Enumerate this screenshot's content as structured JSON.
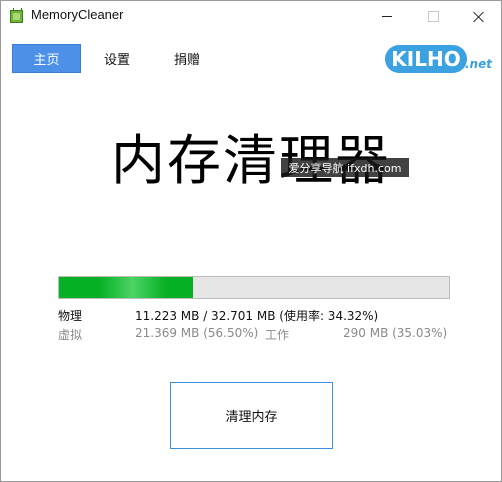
{
  "window": {
    "title": "MemoryCleaner"
  },
  "nav": {
    "home": "主页",
    "settings": "设置",
    "donate": "捐赠"
  },
  "logo": {
    "main": "KILHO",
    "suffix": ".net"
  },
  "main": {
    "heading": "内存清理器",
    "watermark": "爱分享导航 ifxdh.com"
  },
  "memory": {
    "usage_fraction": 0.3432,
    "physical_label": "物理",
    "physical_value": "11.223 MB / 32.701 MB (使用率: 34.32%)",
    "virtual_label": "虚拟",
    "virtual_value": "21.369 MB (56.50%)",
    "working_label": "工作",
    "working_value": "290 MB (35.03%)"
  },
  "actions": {
    "clean_label": "清理内存"
  },
  "colors": {
    "accent": "#4d90e8",
    "progress": "#06b025",
    "logo": "#3ba1e0"
  }
}
